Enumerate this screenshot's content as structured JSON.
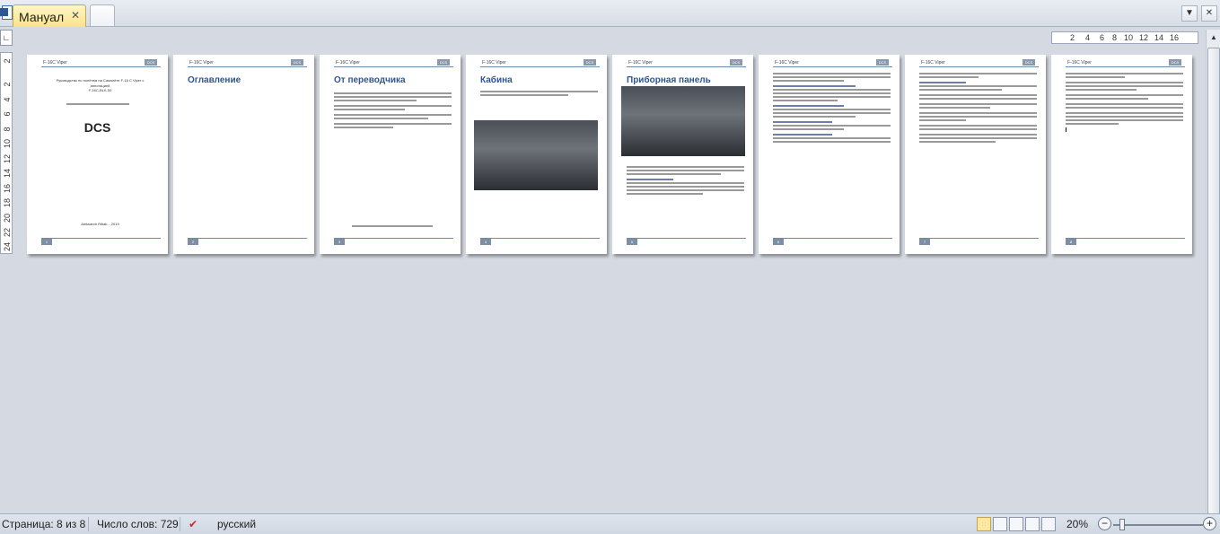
{
  "tabs": {
    "active_title": "Мануал",
    "close_glyph": "✕"
  },
  "window": {
    "dropdown_glyph": "▼",
    "close_glyph": "✕"
  },
  "ruler": {
    "corner_glyph": "∟",
    "h_ticks": [
      "2",
      "4",
      "6",
      "8",
      "10",
      "12",
      "14",
      "16"
    ],
    "v_ticks": [
      "2",
      "2",
      "4",
      "6",
      "8",
      "10",
      "12",
      "14",
      "16",
      "18",
      "20",
      "22",
      "24"
    ]
  },
  "pages": [
    {
      "header": "F-16C Viper",
      "badge": "DCS",
      "num": "1",
      "cover_title": "DCS",
      "cover_lines": [
        "Руководство по полётам на Самолёте F-16 C Viper с",
        "аннотацией",
        "F-16C-BLK-50"
      ],
      "author": "Aleksandr Ribak... 2019"
    },
    {
      "header": "F-16C Viper",
      "badge": "DCS",
      "num": "2",
      "title": "Оглавление"
    },
    {
      "header": "F-16C Viper",
      "badge": "DCS",
      "num": "3",
      "title": "От переводчика"
    },
    {
      "header": "F-16C Viper",
      "badge": "DCS",
      "num": "4",
      "title": "Кабина"
    },
    {
      "header": "F-16C Viper",
      "badge": "DCS",
      "num": "5",
      "title": "Приборная панель"
    },
    {
      "header": "F-16C Viper",
      "badge": "DCS",
      "num": "6"
    },
    {
      "header": "F-16C Viper",
      "badge": "DCS",
      "num": "7"
    },
    {
      "header": "F-16C Viper",
      "badge": "DCS",
      "num": "8"
    }
  ],
  "status": {
    "page": "Страница: 8 из 8",
    "words": "Число слов: 729",
    "language": "русский",
    "zoom": "20%",
    "zoom_out": "−",
    "zoom_in": "+"
  },
  "colors": {
    "title_blue": "#2d5595",
    "accent_yellow": "#f8e38a",
    "status_bg": "#cfd7e2"
  }
}
